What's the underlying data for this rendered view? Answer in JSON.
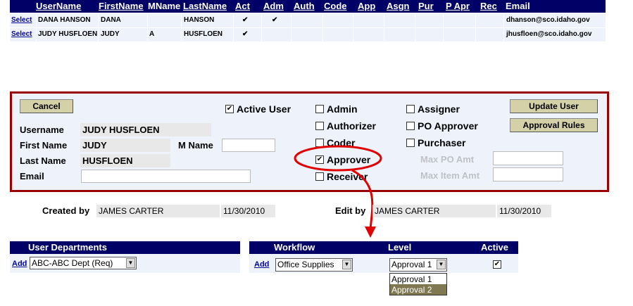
{
  "grid": {
    "headers": [
      "UserName",
      "FirstName",
      "MName",
      "LastName",
      "Act",
      "Adm",
      "Auth",
      "Code",
      "App",
      "Asgn",
      "Pur",
      "P Apr",
      "Rec",
      "Email"
    ],
    "rows": [
      {
        "select": "Select",
        "username": "DANA HANSON",
        "first": "DANA",
        "mname": "",
        "last": "HANSON",
        "act": "✔",
        "adm": "✔",
        "email": "dhanson@sco.idaho.gov"
      },
      {
        "select": "Select",
        "username": "JUDY HUSFLOEN",
        "first": "JUDY",
        "mname": "A",
        "last": "HUSFLOEN",
        "act": "✔",
        "adm": "",
        "email": "jhusfloen@sco.idaho.gov"
      }
    ]
  },
  "form": {
    "cancel_label": "Cancel",
    "update_user_label": "Update User",
    "approval_rules_label": "Approval Rules",
    "active_user_label": "Active User",
    "username_label": "Username",
    "username_value": "JUDY HUSFLOEN",
    "first_name_label": "First Name",
    "first_name_value": "JUDY",
    "mname_label": "M Name",
    "last_name_label": "Last Name",
    "last_name_value": "HUSFLOEN",
    "email_label": "Email",
    "roles": {
      "admin": "Admin",
      "authorizer": "Authorizer",
      "coder": "Coder",
      "approver": "Approver",
      "receiver": "Receiver",
      "assigner": "Assigner",
      "po_approver": "PO Approver",
      "purchaser": "Purchaser"
    },
    "max_po_label": "Max PO Amt",
    "max_item_label": "Max Item Amt"
  },
  "info": {
    "created_by_label": "Created by",
    "created_by_value": "JAMES CARTER",
    "created_date": "11/30/2010",
    "edit_by_label": "Edit by",
    "edit_by_value": "JAMES CARTER",
    "edit_date": "11/30/2010"
  },
  "departments": {
    "header": "User Departments",
    "add_label": "Add",
    "selected": "ABC-ABC Dept (Req)"
  },
  "workflow": {
    "header_workflow": "Workflow",
    "header_level": "Level",
    "header_active": "Active",
    "add_label": "Add",
    "workflow_selected": "Office Supplies",
    "level_selected": "Approval 1",
    "level_options": [
      "Approval 1",
      "Approval 2"
    ]
  },
  "colors": {
    "header_blue": "#000066",
    "panel_border": "#990000",
    "annotation_red": "#e00000",
    "row_bg": "#eef3fb"
  }
}
